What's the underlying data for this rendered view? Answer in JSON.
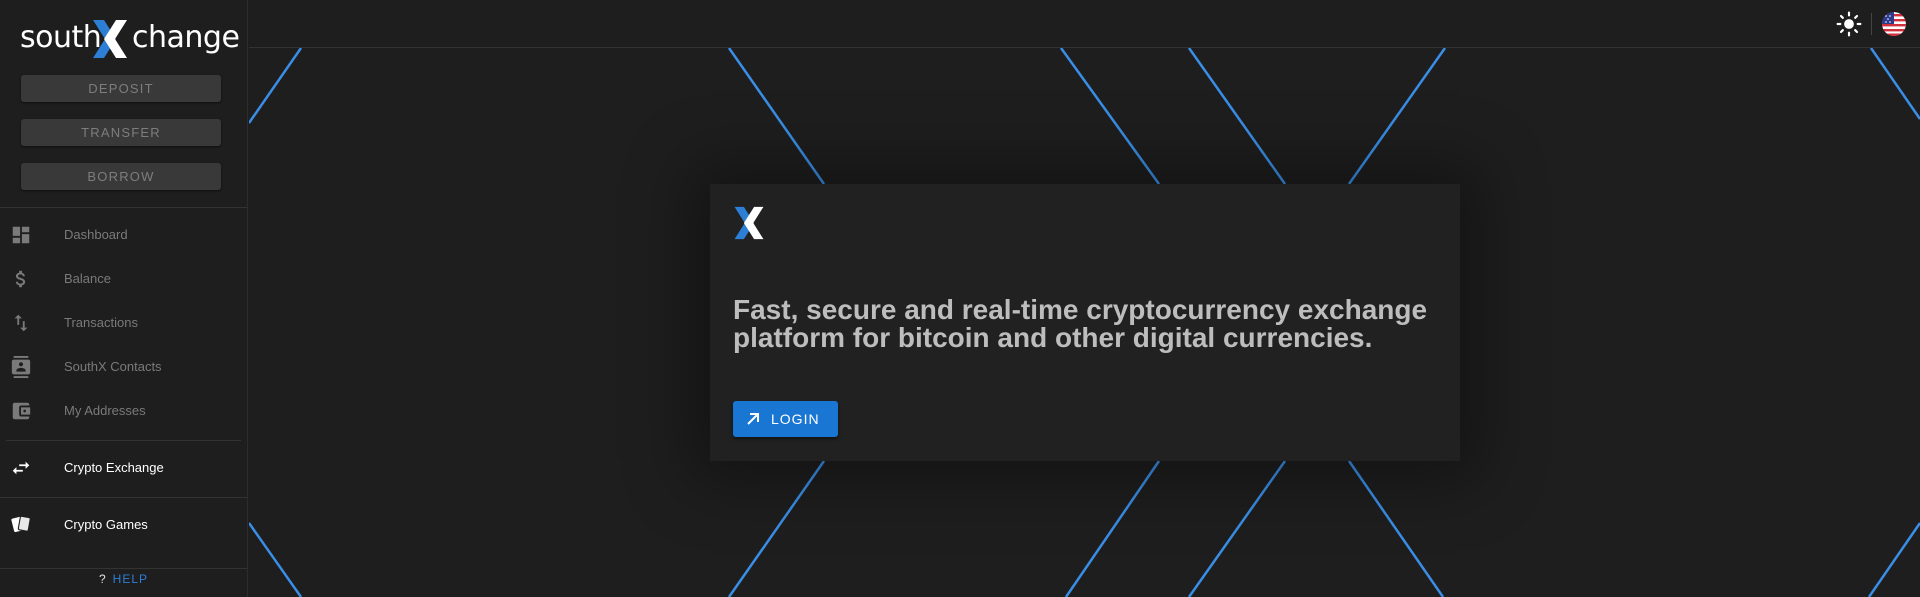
{
  "brand": {
    "left": "south",
    "right": "change",
    "accent": "#2d7fd6"
  },
  "actions": [
    {
      "label": "DEPOSIT"
    },
    {
      "label": "TRANSFER"
    },
    {
      "label": "BORROW"
    }
  ],
  "nav": [
    {
      "label": "Dashboard",
      "icon": "dashboard-icon"
    },
    {
      "label": "Balance",
      "icon": "dollar-icon"
    },
    {
      "label": "Transactions",
      "icon": "transactions-icon"
    },
    {
      "label": "SouthX Contacts",
      "icon": "contacts-icon"
    },
    {
      "label": "My Addresses",
      "icon": "wallet-icon"
    }
  ],
  "exchange": {
    "label": "Crypto Exchange",
    "icon": "swap-icon"
  },
  "games": {
    "label": "Crypto Games",
    "icon": "cards-icon"
  },
  "help": {
    "icon_text": "?",
    "label": "HELP"
  },
  "topbar": {
    "theme_icon": "sun-icon",
    "language_icon": "us-flag-icon"
  },
  "hero": {
    "title": "Fast, secure and real-time cryptocurrency exchange platform for bitcoin and other digital currencies.",
    "login_label": "LOGIN"
  },
  "colors": {
    "background": "#1e1e1e",
    "card": "#212121",
    "primary": "#1976d2",
    "lines": "#3a8ee6"
  }
}
